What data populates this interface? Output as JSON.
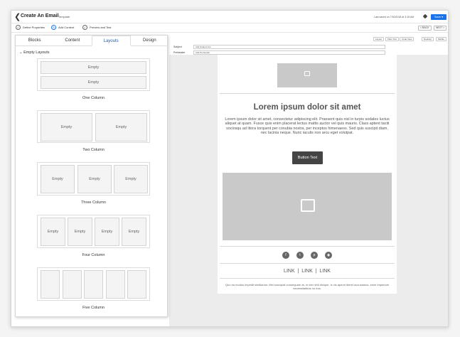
{
  "header": {
    "back_icon": "chevron-left-icon",
    "title": "Create An Email",
    "tag": "Template",
    "last_saved": "Last saved on 7/30/2018 at 3:15 AM",
    "save_label": "Save"
  },
  "steps": [
    {
      "label": "Define Properties"
    },
    {
      "label": "Add Content"
    },
    {
      "label": "Preview and Test"
    }
  ],
  "nav": {
    "back": "< BACK",
    "next": "NEXT >"
  },
  "view_toggles": [
    "Layout",
    "Plain Text",
    "Code View"
  ],
  "device_toggles": [
    "Desktop",
    "Mobile"
  ],
  "fields": {
    "subject_label": "Subject",
    "subject_value": "Add Subject line",
    "preheader_label": "Preheader",
    "preheader_value": "Add Preheader"
  },
  "panel": {
    "tabs": [
      "Blocks",
      "Content",
      "Layouts",
      "Design"
    ],
    "active_tab": "Layouts",
    "section": "Empty Layouts",
    "cell_label": "Empty",
    "layouts": [
      {
        "caption": "One Column"
      },
      {
        "caption": "Two Column"
      },
      {
        "caption": "Three Column"
      },
      {
        "caption": "Four Column"
      },
      {
        "caption": "Five Column"
      }
    ]
  },
  "email": {
    "title": "Lorem ipsum dolor sit amet",
    "body": "Lorem ipsum dolor sit amet, consectetur adipiscing elit. Praesent quis nisl in turpis sodales luctus aliquet at quam. Fusce quis enim placerat lectus mattis auctor vel quis mauris. Class aptent taciti sociosqu ad litora torquent per conubia nostra, per inceptos himenaeos. Sed quis suscipit diam, nec lacinia neque. Nunc iaculis non arcu eget volutpat.",
    "button": "Button Text",
    "social_icons": [
      "facebook-icon",
      "twitter-icon",
      "pinterest-icon",
      "instagram-icon"
    ],
    "links": [
      "LINK",
      "LINK",
      "LINK"
    ],
    "footer": "Quo ea modus impedit similiantur. Mei suscipiat consequam at, in vim nihil dicique. Is vis apeuri iberet accusamus, enim Imperium necessitatibus no eos."
  }
}
